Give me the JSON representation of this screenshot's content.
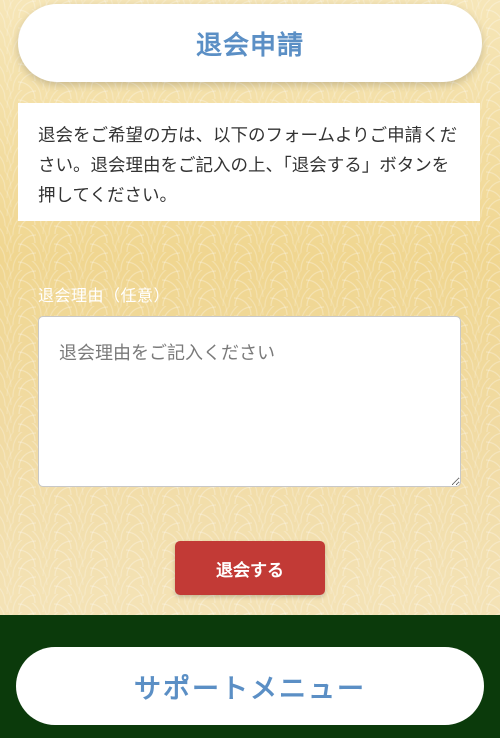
{
  "header": {
    "title": "退会申請"
  },
  "info": {
    "text": "退会をご希望の方は、以下のフォームよりご申請ください。退会理由をご記入の上、「退会する」ボタンを押してください。"
  },
  "form": {
    "reason_label": "退会理由（任意）",
    "reason_value": "",
    "reason_placeholder": "退会理由をご記入ください",
    "submit_label": "退会する"
  },
  "footer": {
    "support_menu_label": "サポートメニュー"
  },
  "colors": {
    "accent_blue": "#5b8fc5",
    "submit_red": "#c23a36",
    "footer_green": "#0b3a0b"
  }
}
